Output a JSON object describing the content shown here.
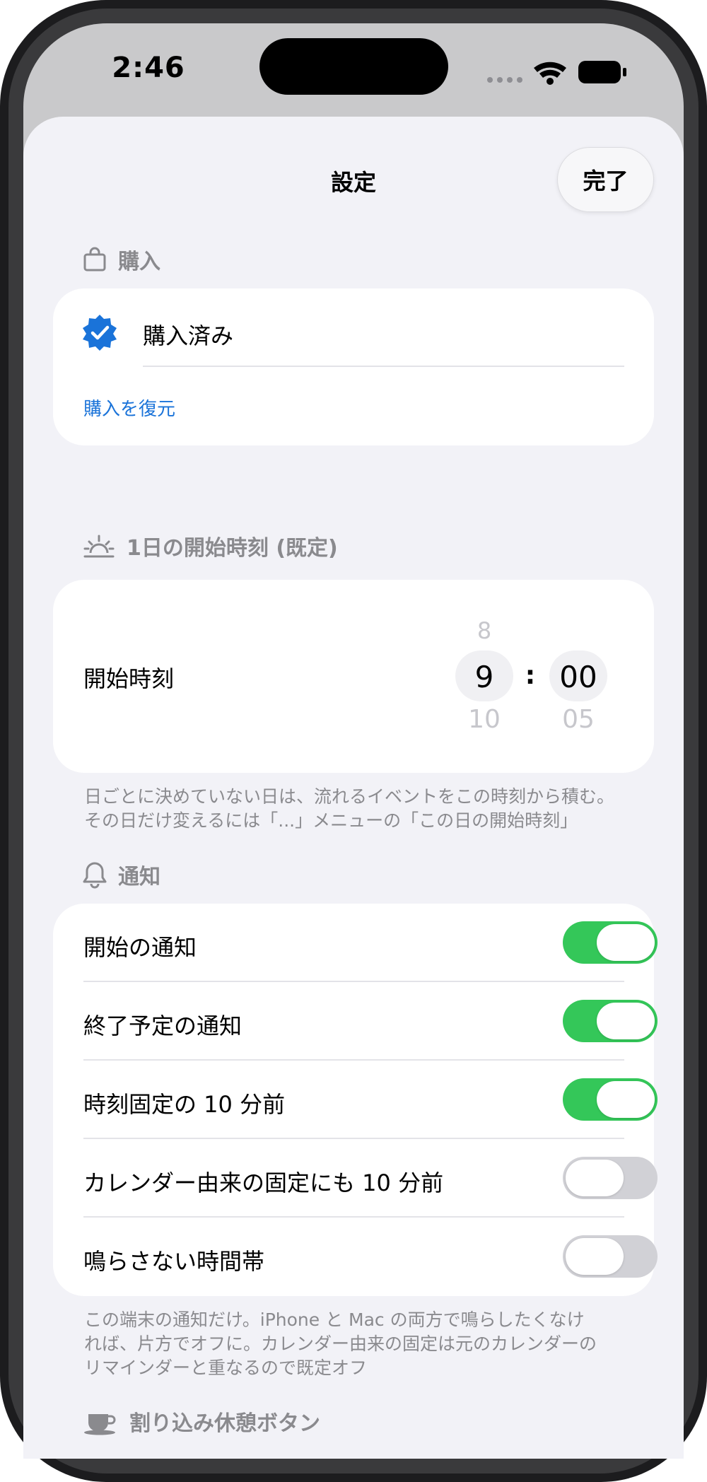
{
  "status_bar": {
    "time": "2:46"
  },
  "header": {
    "title": "設定",
    "done_label": "完了"
  },
  "purchase": {
    "section_title": "購入",
    "status_label": "購入済み",
    "restore_link": "購入を復元"
  },
  "day_start": {
    "section_title": "1日の開始時刻 (既定)",
    "row_label": "開始時刻",
    "hour_prev": "8",
    "hour_selected": "9",
    "hour_next": "10",
    "separator": ":",
    "minute_selected": "00",
    "minute_next": "05",
    "footnote_line1": "日ごとに決めていない日は、流れるイベントをこの時刻から積む。",
    "footnote_line2": "その日だけ変えるには「...」メニューの「この日の開始時刻」"
  },
  "notifications": {
    "section_title": "通知",
    "items": [
      {
        "label": "開始の通知",
        "on": true
      },
      {
        "label": "終了予定の通知",
        "on": true
      },
      {
        "label": "時刻固定の 10 分前",
        "on": true
      },
      {
        "label": "カレンダー由来の固定にも 10 分前",
        "on": false
      },
      {
        "label": "鳴らさない時間帯",
        "on": false
      }
    ],
    "footnote_line1": "この端末の通知だけ。iPhone と Mac の両方で鳴らしたくなけ",
    "footnote_line2": "れば、片方でオフに。カレンダー由来の固定は元のカレンダーの",
    "footnote_line3": "リマインダーと重なるので既定オフ"
  },
  "break_button": {
    "section_title": "割り込み休憩ボタン"
  },
  "colors": {
    "accent": "#1a73d9",
    "toggle_on": "#34c759",
    "toggle_off": "#d1d1d6"
  }
}
